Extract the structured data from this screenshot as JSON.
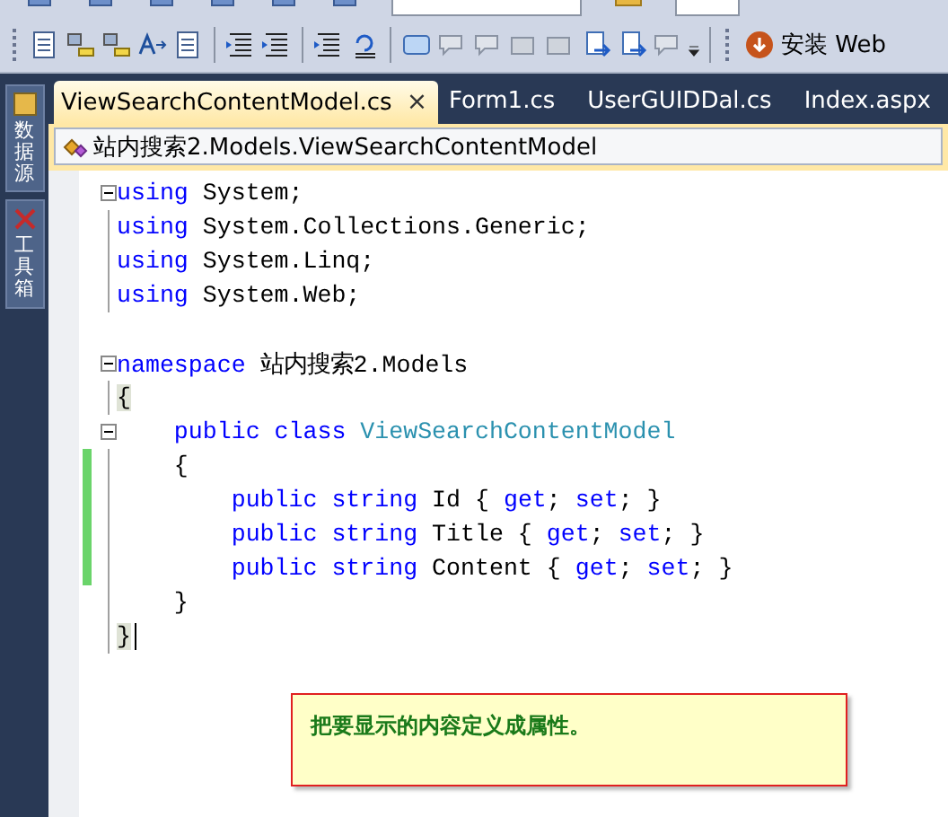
{
  "toolbar": {
    "install_button": "安装 Web"
  },
  "side_tabs": [
    {
      "label": "数据源"
    },
    {
      "label": "工具箱"
    }
  ],
  "tabs": [
    {
      "label": "ViewSearchContentModel.cs",
      "selected": true,
      "close": "×"
    },
    {
      "label": "Form1.cs",
      "selected": false
    },
    {
      "label": "UserGUIDDal.cs",
      "selected": false
    },
    {
      "label": "Index.aspx",
      "selected": false
    }
  ],
  "breadcrumb": "站内搜索2.Models.ViewSearchContentModel",
  "code": [
    {
      "foldable": true,
      "changed": false,
      "caret": false,
      "tokens": [
        {
          "kind": "kw",
          "text": "using"
        },
        {
          "kind": "plain",
          "text": " System;"
        }
      ]
    },
    {
      "foldable": false,
      "changed": false,
      "caret": false,
      "tokens": [
        {
          "kind": "kw",
          "text": "using"
        },
        {
          "kind": "plain",
          "text": " System.Collections.Generic;"
        }
      ]
    },
    {
      "foldable": false,
      "changed": false,
      "caret": false,
      "tokens": [
        {
          "kind": "kw",
          "text": "using"
        },
        {
          "kind": "plain",
          "text": " System.Linq;"
        }
      ]
    },
    {
      "foldable": false,
      "changed": false,
      "caret": false,
      "tokens": [
        {
          "kind": "kw",
          "text": "using"
        },
        {
          "kind": "plain",
          "text": " System.Web;"
        }
      ]
    },
    {
      "foldable": false,
      "changed": false,
      "caret": false
    },
    {
      "foldable": true,
      "changed": false,
      "caret": false,
      "tokens": [
        {
          "kind": "kw",
          "text": "namespace"
        },
        {
          "kind": "plain",
          "text": " 站内搜索2.Models"
        }
      ]
    },
    {
      "foldable": false,
      "changed": false,
      "caret": false,
      "tokens": [
        {
          "kind": "match",
          "text": "{"
        }
      ]
    },
    {
      "foldable": true,
      "changed": false,
      "caret": false,
      "tokens": [
        {
          "kind": "kw",
          "text": "    public class"
        },
        {
          "kind": "type",
          "text": " ViewSearchContentModel"
        }
      ]
    },
    {
      "foldable": false,
      "changed": true,
      "caret": false,
      "tokens": [
        {
          "kind": "plain",
          "text": "    {"
        }
      ]
    },
    {
      "foldable": false,
      "changed": true,
      "caret": false,
      "tokens": [
        {
          "kind": "kw",
          "text": "        public string"
        },
        {
          "kind": "plain",
          "text": " Id { "
        },
        {
          "kind": "kw",
          "text": "get"
        },
        {
          "kind": "plain",
          "text": "; "
        },
        {
          "kind": "kw",
          "text": "set"
        },
        {
          "kind": "plain",
          "text": "; }"
        }
      ]
    },
    {
      "foldable": false,
      "changed": true,
      "caret": false,
      "tokens": [
        {
          "kind": "kw",
          "text": "        public string"
        },
        {
          "kind": "plain",
          "text": " Title { "
        },
        {
          "kind": "kw",
          "text": "get"
        },
        {
          "kind": "plain",
          "text": "; "
        },
        {
          "kind": "kw",
          "text": "set"
        },
        {
          "kind": "plain",
          "text": "; }"
        }
      ]
    },
    {
      "foldable": false,
      "changed": true,
      "caret": false,
      "tokens": [
        {
          "kind": "kw",
          "text": "        public string"
        },
        {
          "kind": "plain",
          "text": " Content { "
        },
        {
          "kind": "kw",
          "text": "get"
        },
        {
          "kind": "plain",
          "text": "; "
        },
        {
          "kind": "kw",
          "text": "set"
        },
        {
          "kind": "plain",
          "text": "; }"
        }
      ]
    },
    {
      "foldable": false,
      "changed": false,
      "caret": false,
      "tokens": [
        {
          "kind": "plain",
          "text": "    }"
        }
      ]
    },
    {
      "foldable": false,
      "changed": false,
      "caret": true,
      "tokens": [
        {
          "kind": "match",
          "text": "}"
        }
      ]
    }
  ],
  "callout": "把要显示的内容定义成属性。"
}
